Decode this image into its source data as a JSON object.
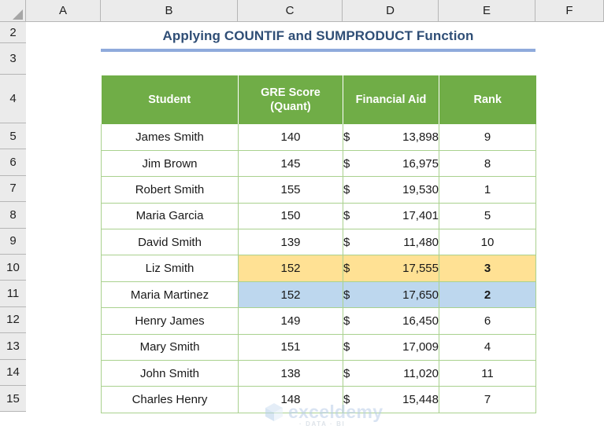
{
  "app": {
    "type": "spreadsheet"
  },
  "grid": {
    "column_headers": [
      "A",
      "B",
      "C",
      "D",
      "E",
      "F"
    ],
    "row_headers": [
      "2",
      "3",
      "4",
      "5",
      "6",
      "7",
      "8",
      "9",
      "10",
      "11",
      "12",
      "13",
      "14",
      "15"
    ],
    "corner_name": "select-all-corner"
  },
  "title": {
    "text": "Applying COUNTIF and SUMPRODUCT Function",
    "color": "#2f4e76",
    "rule_color": "#8faadc"
  },
  "table": {
    "header_bg": "#70ad47",
    "header_text_color": "#ffffff",
    "border_color": "#a9d18e",
    "columns": [
      {
        "label": "Student",
        "key": "student"
      },
      {
        "label": "GRE Score (Quant)",
        "line1": "GRE Score",
        "line2": "(Quant)",
        "key": "score"
      },
      {
        "label": "Financial Aid",
        "key": "aid"
      },
      {
        "label": "Rank",
        "key": "rank"
      }
    ],
    "currency_symbol": "$",
    "rows": [
      {
        "student": "James Smith",
        "score": "140",
        "aid": "13,898",
        "rank": "9",
        "highlight": "none"
      },
      {
        "student": "Jim Brown",
        "score": "145",
        "aid": "16,975",
        "rank": "8",
        "highlight": "none"
      },
      {
        "student": "Robert Smith",
        "score": "155",
        "aid": "19,530",
        "rank": "1",
        "highlight": "none"
      },
      {
        "student": "Maria Garcia",
        "score": "150",
        "aid": "17,401",
        "rank": "5",
        "highlight": "none"
      },
      {
        "student": "David Smith",
        "score": "139",
        "aid": "11,480",
        "rank": "10",
        "highlight": "none"
      },
      {
        "student": "Liz Smith",
        "score": "152",
        "aid": "17,555",
        "rank": "3",
        "highlight": "yellow"
      },
      {
        "student": "Maria Martinez",
        "score": "152",
        "aid": "17,650",
        "rank": "2",
        "highlight": "blue"
      },
      {
        "student": "Henry James",
        "score": "149",
        "aid": "16,450",
        "rank": "6",
        "highlight": "none"
      },
      {
        "student": "Mary Smith",
        "score": "151",
        "aid": "17,009",
        "rank": "4",
        "highlight": "none"
      },
      {
        "student": "John Smith",
        "score": "138",
        "aid": "11,020",
        "rank": "11",
        "highlight": "none"
      },
      {
        "student": "Charles Henry",
        "score": "148",
        "aid": "15,448",
        "rank": "7",
        "highlight": "none"
      }
    ],
    "highlight_colors": {
      "yellow": "#ffe194",
      "blue": "#bdd7ee"
    }
  },
  "watermark": {
    "text": "exceldemy",
    "tagline": "· DATA · BI"
  }
}
